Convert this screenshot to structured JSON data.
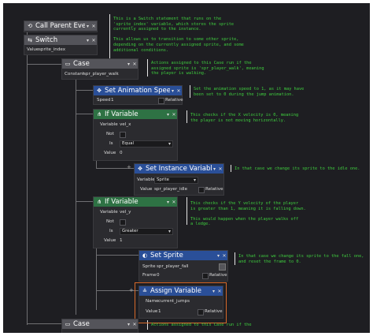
{
  "nodes": {
    "call_parent": {
      "title": "Call Parent Event"
    },
    "switch": {
      "title": "Switch",
      "value_label": "Value",
      "value": "sprite_index"
    },
    "case1": {
      "title": "Case",
      "constant_label": "Constant",
      "constant": "spr_player_walk"
    },
    "set_anim": {
      "title": "Set Animation Speed",
      "speed_label": "Speed",
      "speed": "1",
      "relative_label": "Relative"
    },
    "if1": {
      "title": "If Variable",
      "variable_label": "Variable",
      "variable": "vel_x",
      "not_label": "Not",
      "is_label": "Is",
      "is": "Equal",
      "value_label": "Value",
      "value": "0"
    },
    "set_inst": {
      "title": "Set Instance Variable",
      "variable_label": "Variable",
      "variable": "Sprite",
      "value_label": "Value",
      "value": "spr_player_idle",
      "relative_label": "Relative"
    },
    "if2": {
      "title": "If Variable",
      "variable_label": "Variable",
      "variable": "vel_y",
      "not_label": "Not",
      "is_label": "Is",
      "is": "Greater",
      "value_label": "Value",
      "value": "1"
    },
    "set_sprite": {
      "title": "Set Sprite",
      "sprite_label": "Sprite",
      "sprite": "spr_player_fall",
      "frame_label": "Frame",
      "frame": "0",
      "relative_label": "Relative"
    },
    "assign": {
      "title": "Assign Variable",
      "name_label": "Name",
      "name": "current_jumps",
      "value_label": "Value",
      "value": "1",
      "relative_label": "Relative"
    },
    "case2": {
      "title": "Case"
    }
  },
  "comments": {
    "c1": "This is a Switch statement that runs on the\n'sprite_index' variable, which stores the sprite\ncurrently assigned to the instance.\n\nThis allows us to transition to some other sprite,\ndepending on the currently assigned sprite, and some\nadditional conditions.",
    "c2": "Actions assigned to this Case run if the\nassigned sprite is 'spr_player_walk', meaning\nthe player is walking.",
    "c3": "Set the animation speed to 1, as it may have\nbeen set to 0 during the jump animation.",
    "c4": "This checks if the X velocity is 0, meaning\nthe player is not moving horizontally.",
    "c5": "In that case we change its sprite to the idle one.",
    "c6": "This checks if the Y velocity of the player\nis greater than 1, meaning it is falling down.\n\nThis would happen when the player walks off\na ledge.",
    "c7": "In that case we change its sprite to the fall one,\nand reset the frame to 0.",
    "c8": "Actions assigned to this Case run if the"
  },
  "icons": {
    "call_parent": "⟲",
    "switch": "⇆",
    "case": "▭",
    "anim": "✥",
    "ifvar": "⋔",
    "setvar": "✥",
    "sprite": "◐",
    "assign": "≗",
    "gear": "▾",
    "close": "✕",
    "plus": "+",
    "dropdown": "▾"
  }
}
